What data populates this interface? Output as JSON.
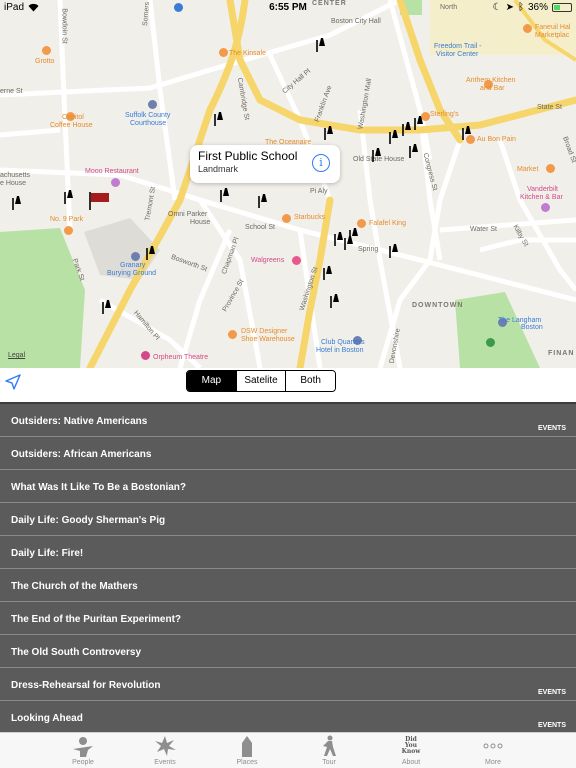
{
  "status_bar": {
    "device": "iPad",
    "time": "6:55 PM",
    "battery": "36%",
    "battery_level": 0.36
  },
  "map": {
    "callout": {
      "title": "First Public School",
      "subtitle": "Landmark"
    },
    "labels": {
      "grotto": "Grotto",
      "kinsale": "The Kinsale",
      "boston_city_hall": "Boston City Hall",
      "freedom_trail": "Freedom Trail -",
      "visitor_center": "Visitor Center",
      "faneuil_1": "Faneuil Hal",
      "faneuil_2": "Marketplac",
      "anthem_1": "Anthem Kitchen",
      "anthem_2": "and Bar",
      "suffolk_1": "Suffolk County",
      "suffolk_2": "Courthouse",
      "capitol_1": "Capitol",
      "capitol_2": "Coffee House",
      "oceanaire": "The Oceanaire",
      "sterlings": "Sterling's",
      "state_st": "State St",
      "au_bon_pain": "Au Bon Pain",
      "mooo": "Mooo Restaurant",
      "old_state_house": "Old State House",
      "market": "Market",
      "vanderbilt_1": "Vanderbilt",
      "vanderbilt_2": "Kitchen & Bar",
      "chusetts_1": "achusetts",
      "chusetts_2": "e House",
      "pi_aly": "Pi Aly",
      "omni_1": "Omni Parker",
      "omni_2": "House",
      "starbucks": "Starbucks",
      "falafel": "Falafel King",
      "no9": "No. 9 Park",
      "granary_1": "Granary",
      "granary_2": "Burying Ground",
      "walgreens": "Walgreens",
      "school_st": "School St",
      "water_st": "Water St",
      "spring": "Spring",
      "downtown": "DOWNTOWN",
      "langham_1": "The Langham",
      "langham_2": "Boston",
      "dsw_1": "DSW Designer",
      "dsw_2": "Shoe Warehouse",
      "club_1": "Club Quarters",
      "club_2": "Hotel in Boston",
      "orpheum": "Orpheum Theatre",
      "finan": "FINAN",
      "park_st": "Park St",
      "tremont_st": "Tremont St",
      "washington_st": "Washington St",
      "cambridge_st": "Cambridge St",
      "congress_st": "Congress St",
      "hamilton_pl": "Hamilton Pl",
      "bosworth_st": "Bosworth St",
      "chapman_pl": "Chapman Pl",
      "province_st": "Province St",
      "bowdoin_st": "Bowdoin St",
      "somerset_st": "Somers",
      "city_hall_pl": "City Hall Pl",
      "franklin_ave": "Franklin Ave",
      "washington_mall": "Washington Mall",
      "kilby_st": "Kilby St",
      "broad_st": "Broad St",
      "devonshire": "Devonshire",
      "center": "CENTER",
      "north": "North",
      "erne_st": "erne St"
    },
    "legal": "Legal"
  },
  "segmented": {
    "options": [
      "Map",
      "Satelite",
      "Both"
    ],
    "selected": "Map"
  },
  "list": {
    "items": [
      {
        "label": "Outsiders: Native Americans",
        "tag": "EVENTS"
      },
      {
        "label": "Outsiders: African Americans",
        "tag": ""
      },
      {
        "label": "What Was It Like To Be a Bostonian?",
        "tag": ""
      },
      {
        "label": "Daily Life: Goody Sherman's Pig",
        "tag": ""
      },
      {
        "label": "Daily Life: Fire!",
        "tag": ""
      },
      {
        "label": "The Church of the Mathers",
        "tag": ""
      },
      {
        "label": "The End of the Puritan Experiment?",
        "tag": ""
      },
      {
        "label": "The Old South Controversy",
        "tag": ""
      },
      {
        "label": "Dress-Rehearsal for Revolution",
        "tag": "EVENTS"
      },
      {
        "label": "Looking Ahead",
        "tag": "EVENTS"
      }
    ]
  },
  "tabbar": {
    "tabs": [
      {
        "label": "People",
        "icon": "people-icon"
      },
      {
        "label": "Events",
        "icon": "events-icon"
      },
      {
        "label": "Places",
        "icon": "places-icon"
      },
      {
        "label": "Tour",
        "icon": "tour-icon"
      },
      {
        "label": "About",
        "icon": "did-you-know-icon",
        "icon_text": "Did You Know"
      },
      {
        "label": "More",
        "icon": "more-icon"
      }
    ]
  },
  "colors": {
    "map_background": "#f1efe9",
    "road_yellow": "#f6d56b",
    "park_green": "#b8e2a5",
    "list_background": "#5b5b5b",
    "segment_active": "#000000",
    "callout_info": "#2f7cf6"
  }
}
